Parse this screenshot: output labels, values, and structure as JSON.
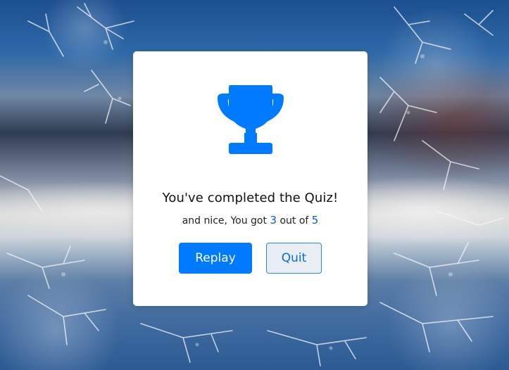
{
  "background": {
    "name": "frosted glass background"
  },
  "modal": {
    "icon": "trophy-icon",
    "title": "You've completed the Quiz!",
    "score_prefix": "and nice, You got",
    "score_correct": "3",
    "score_middle": "out of",
    "score_total": "5",
    "buttons": {
      "replay_label": "Replay",
      "quit_label": "Quit"
    }
  },
  "colors": {
    "accent": "#007bff",
    "card": "#ffffff",
    "score_number": "#0a5bd6"
  }
}
